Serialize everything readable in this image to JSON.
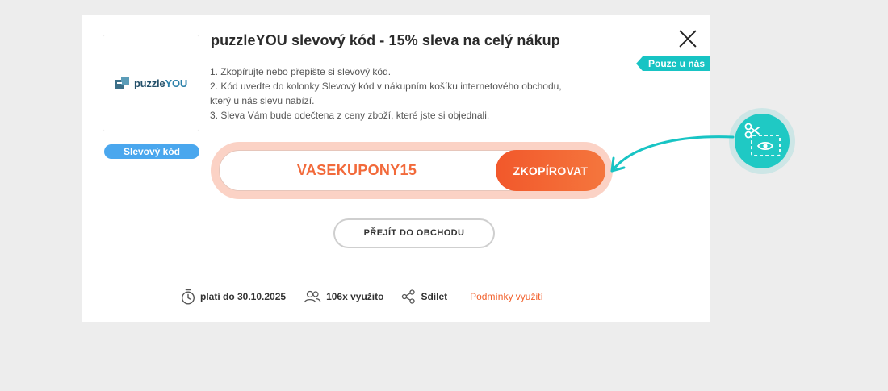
{
  "modal": {
    "title": "puzzleYOU slevový kód - 15% sleva na celý nákup",
    "ribbon": "Pouze u nás",
    "badge": "Slevový kód",
    "logo": {
      "name_main": "puzzle",
      "name_accent": "YOU"
    },
    "instructions": [
      "1. Zkopírujte nebo přepište si slevový kód.",
      "2. Kód uveďte do kolonky Slevový kód v nákupním košíku internetového obchodu, který u nás slevu nabízí.",
      "3. Sleva Vám bude odečtena z ceny zboží, které jste si objednali."
    ],
    "code": "VASEKUPONY15",
    "copy_label": "ZKOPÍROVAT",
    "shop_label": "PŘEJÍT DO OBCHODU",
    "footer": {
      "valid": "platí do 30.10.2025",
      "used": "106x využito",
      "share": "Sdílet",
      "terms": "Podmínky využití"
    }
  },
  "colors": {
    "accent": "#f2622e",
    "teal": "#18c4c4",
    "badge": "#4aa7ee",
    "code_ring": "#fbd2c5"
  },
  "icons": [
    "close-icon",
    "timer-icon",
    "users-icon",
    "share-icon",
    "scissors-coupon-icon",
    "arrow-icon"
  ]
}
